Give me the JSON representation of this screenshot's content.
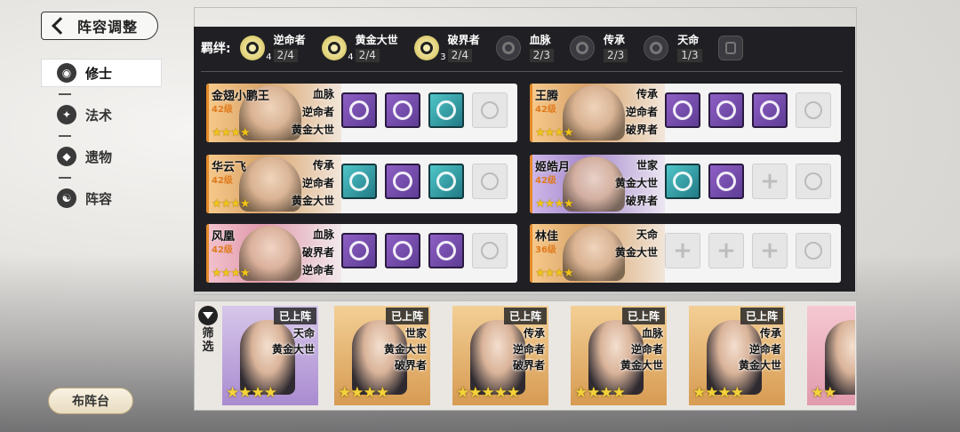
{
  "header": {
    "title": "阵容调整"
  },
  "nav": {
    "items": [
      {
        "label": "修士",
        "active": true
      },
      {
        "label": "法术",
        "active": false
      },
      {
        "label": "遗物",
        "active": false
      },
      {
        "label": "阵容",
        "active": false
      }
    ],
    "deploy_button": "布阵台"
  },
  "bonds": {
    "label": "羁绊:",
    "items": [
      {
        "name": "逆命者",
        "count": "2/4",
        "level": "4",
        "active": true
      },
      {
        "name": "黄金大世",
        "count": "2/4",
        "level": "4",
        "active": true
      },
      {
        "name": "破界者",
        "count": "2/4",
        "level": "3",
        "active": true
      },
      {
        "name": "血脉",
        "count": "2/3",
        "level": "",
        "active": false
      },
      {
        "name": "传承",
        "count": "2/3",
        "level": "",
        "active": false
      },
      {
        "name": "天命",
        "count": "1/3",
        "level": "",
        "active": false
      }
    ]
  },
  "team": [
    {
      "name": "金翅小鹏王",
      "level": "42级",
      "stars": "★★★★",
      "tags": [
        "血脉",
        "逆命者",
        "黄金大世"
      ],
      "skills": [
        "purple",
        "purple",
        "teal",
        "locked"
      ],
      "theme": "gold"
    },
    {
      "name": "王腾",
      "level": "42级",
      "stars": "★★★★",
      "tags": [
        "传承",
        "逆命者",
        "破界者"
      ],
      "skills": [
        "purple",
        "purple",
        "purple",
        "locked"
      ],
      "theme": "gold"
    },
    {
      "name": "华云飞",
      "level": "42级",
      "stars": "★★★★",
      "tags": [
        "传承",
        "逆命者",
        "黄金大世"
      ],
      "skills": [
        "teal",
        "purple",
        "teal",
        "locked"
      ],
      "theme": "gold"
    },
    {
      "name": "姬皓月",
      "level": "42级",
      "stars": "★★★★",
      "tags": [
        "世家",
        "黄金大世",
        "破界者"
      ],
      "skills": [
        "teal",
        "purple",
        "empty",
        "locked"
      ],
      "theme": "purple"
    },
    {
      "name": "风凰",
      "level": "42级",
      "stars": "★★★★",
      "tags": [
        "血脉",
        "破界者",
        "逆命者"
      ],
      "skills": [
        "purple",
        "purple",
        "purple",
        "locked"
      ],
      "theme": "pink"
    },
    {
      "name": "林佳",
      "level": "36级",
      "stars": "★★★★",
      "tags": [
        "天命",
        "黄金大世"
      ],
      "skills": [
        "empty",
        "empty",
        "empty",
        "locked"
      ],
      "theme": "gold"
    }
  ],
  "roster": {
    "filter_label": "筛选",
    "cards": [
      {
        "badge": "已上阵",
        "tags": [
          "天命",
          "黄金大世"
        ],
        "stars": "★★★★",
        "theme": "purple"
      },
      {
        "badge": "已上阵",
        "tags": [
          "世家",
          "黄金大世",
          "破界者"
        ],
        "stars": "★★★★",
        "theme": "gold"
      },
      {
        "badge": "已上阵",
        "tags": [
          "传承",
          "逆命者",
          "破界者"
        ],
        "stars": "★★★★★",
        "theme": "gold"
      },
      {
        "badge": "已上阵",
        "tags": [
          "血脉",
          "逆命者",
          "黄金大世"
        ],
        "stars": "★★★★",
        "theme": "gold"
      },
      {
        "badge": "已上阵",
        "tags": [
          "传承",
          "逆命者",
          "黄金大世"
        ],
        "stars": "★★★★",
        "theme": "gold"
      },
      {
        "badge": "",
        "tags": [],
        "stars": "★★",
        "theme": "pink"
      }
    ]
  }
}
